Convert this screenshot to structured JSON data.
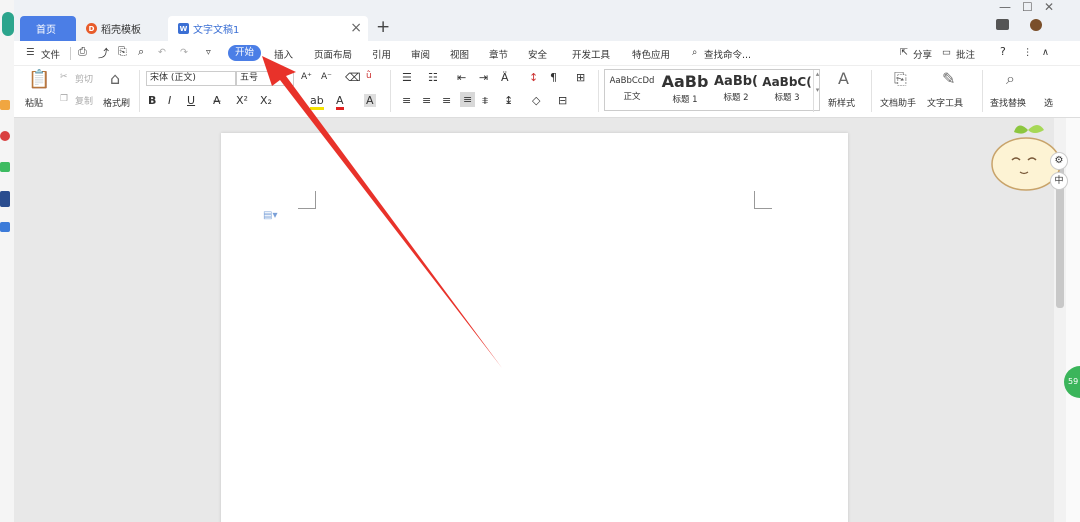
{
  "tabs": {
    "home": "首页",
    "templates": "稻壳模板",
    "document": "文字文稿1",
    "add": "+",
    "close": "×"
  },
  "window": {
    "minimize": "—",
    "maximize": "☐",
    "close": "✕"
  },
  "menu": {
    "file": "文件",
    "start": "开始",
    "insert": "插入",
    "page_layout": "页面布局",
    "references": "引用",
    "review": "审阅",
    "view": "视图",
    "chapter": "章节",
    "security": "安全",
    "dev_tools": "开发工具",
    "special_apps": "特色应用",
    "search_cmd": "查找命令...",
    "share": "分享",
    "comment": "批注",
    "help": "?",
    "more": "⋮",
    "collapse": "∧"
  },
  "ribbon": {
    "paste": "粘贴",
    "cut": "剪切",
    "copy": "复制",
    "format_painter": "格式刷",
    "font_name": "宋体 (正文)",
    "font_size": "五号",
    "bold": "B",
    "italic": "I",
    "underline": "U",
    "grow": "A⁺",
    "shrink": "A⁻",
    "styles": [
      {
        "preview": "AaBbCcDd",
        "label": "正文"
      },
      {
        "preview": "AaBb",
        "label": "标题 1"
      },
      {
        "preview": "AaBb(",
        "label": "标题 2"
      },
      {
        "preview": "AaBbC(",
        "label": "标题 3"
      }
    ],
    "new_style": "新样式",
    "doc_assistant": "文档助手",
    "text_tools": "文字工具",
    "find_replace": "查找替换",
    "select": "选"
  },
  "mascot_badges": {
    "gear": "⚙",
    "chinese": "中"
  },
  "badge_count": "59",
  "colors": {
    "accent": "#4b7ee6",
    "arrow": "#e8322a",
    "tab_home": "#4b7ee6"
  }
}
